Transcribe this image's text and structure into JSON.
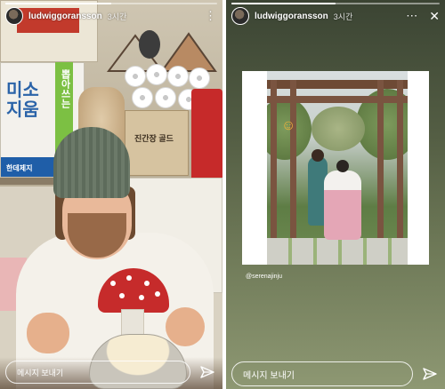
{
  "left_story": {
    "username": "ludwiggoransson",
    "time": "3시간",
    "progress": 0.5,
    "message_placeholder": "메시지 보내기",
    "box_text_main": "미소\n지움",
    "box_text_vertical": "뽑아쓰는",
    "box_text_bottom": "한데제지",
    "box_mid_label": "진간장 골드",
    "more_icon": "more-icon",
    "send_icon": "send-icon"
  },
  "right_story": {
    "username": "ludwiggoransson",
    "time": "3시간",
    "progress": 0.5,
    "emoji": "☺",
    "mention": "@serenajinju",
    "message_placeholder": "메시지 보내기",
    "more_icon": "more-icon",
    "close_icon": "close-icon",
    "send_icon": "send-icon"
  }
}
